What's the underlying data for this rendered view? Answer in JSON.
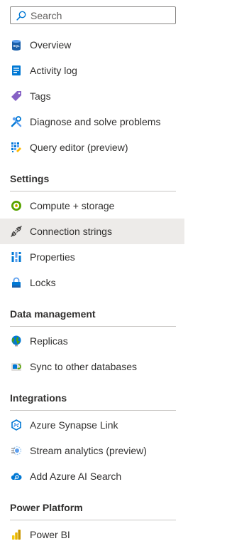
{
  "search": {
    "placeholder": "Search",
    "icon": "search-icon"
  },
  "top_items": [
    {
      "label": "Overview",
      "icon": "sql-database-icon"
    },
    {
      "label": "Activity log",
      "icon": "activity-log-icon"
    },
    {
      "label": "Tags",
      "icon": "tag-icon"
    },
    {
      "label": "Diagnose and solve problems",
      "icon": "wrench-icon"
    },
    {
      "label": "Query editor (preview)",
      "icon": "query-editor-icon"
    }
  ],
  "sections": [
    {
      "title": "Settings",
      "items": [
        {
          "label": "Compute + storage",
          "icon": "compute-storage-icon"
        },
        {
          "label": "Connection strings",
          "icon": "plug-icon",
          "selected": true
        },
        {
          "label": "Properties",
          "icon": "properties-icon"
        },
        {
          "label": "Locks",
          "icon": "lock-icon"
        }
      ]
    },
    {
      "title": "Data management",
      "items": [
        {
          "label": "Replicas",
          "icon": "globe-icon"
        },
        {
          "label": "Sync to other databases",
          "icon": "sync-icon"
        }
      ]
    },
    {
      "title": "Integrations",
      "items": [
        {
          "label": "Azure Synapse Link",
          "icon": "synapse-icon"
        },
        {
          "label": "Stream analytics (preview)",
          "icon": "stream-analytics-icon"
        },
        {
          "label": "Add Azure AI Search",
          "icon": "cloud-search-icon"
        }
      ]
    },
    {
      "title": "Power Platform",
      "items": [
        {
          "label": "Power BI",
          "icon": "power-bi-icon"
        }
      ]
    }
  ],
  "colors": {
    "selected_bg": "#edebe9",
    "text": "#323130",
    "divider": "#c8c6c4",
    "accent": "#0078d4"
  }
}
